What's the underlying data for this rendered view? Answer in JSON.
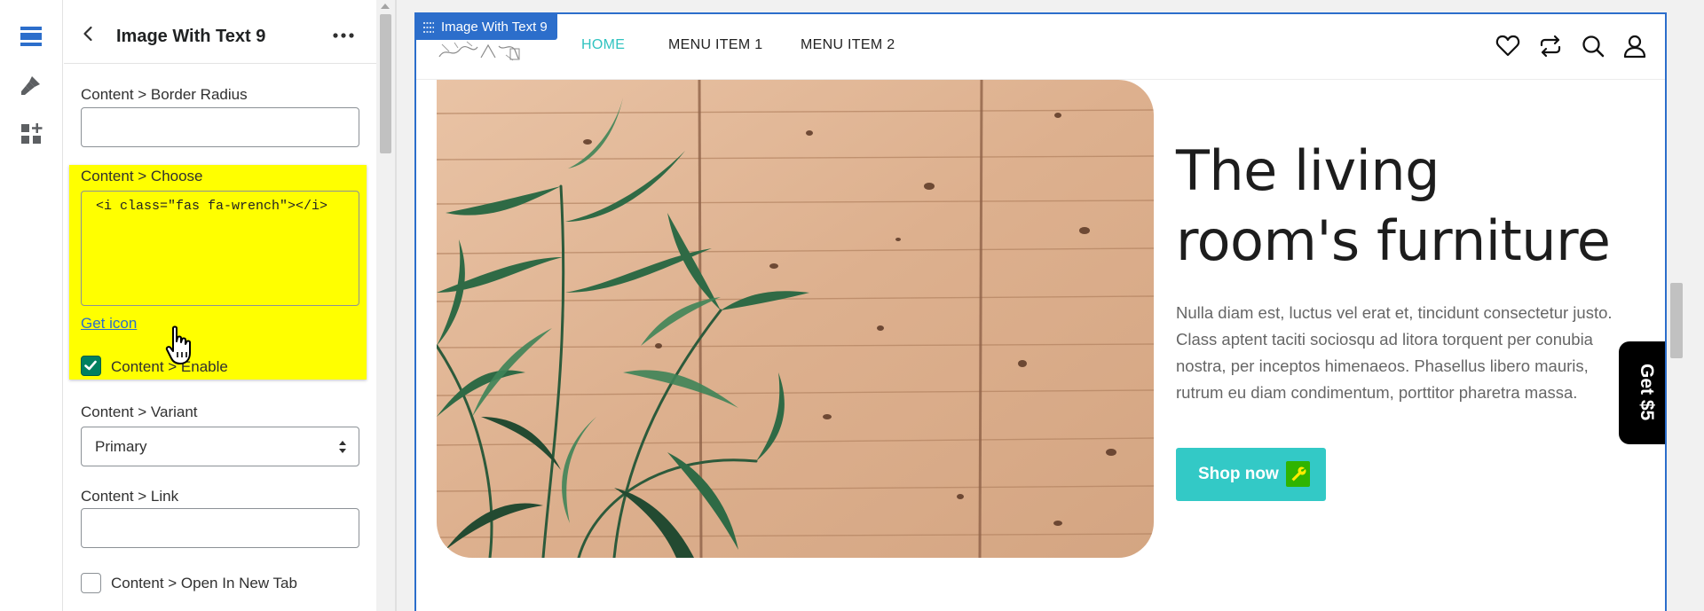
{
  "panel": {
    "title": "Image With Text 9",
    "fields": {
      "border_radius_label": "Content > Border Radius",
      "border_radius_value": "",
      "choose_label": "Content > Choose",
      "choose_value": "<i class=\"fas fa-wrench\"></i>",
      "get_icon_link": "Get icon",
      "enable_label": "Content > Enable",
      "enable_checked": true,
      "variant_label": "Content > Variant",
      "variant_value": "Primary",
      "link_label": "Content > Link",
      "link_value": "",
      "new_tab_label": "Content > Open In New Tab",
      "new_tab_checked": false
    }
  },
  "preview": {
    "section_badge": "Image With Text 9",
    "nav": [
      "HOME",
      "MENU ITEM 1",
      "MENU ITEM 2"
    ],
    "hero": {
      "title": "The living room's furniture",
      "text": "Nulla diam est, luctus vel erat et, tincidunt consectetur justo. Class aptent taciti sociosqu ad litora torquent per conubia nostra, per inceptos himenaeos. Phasellus libero mauris, rutrum eu diam condimentum, porttitor pharetra massa.",
      "button_label": "Shop now"
    },
    "promo_tab": "Get $5"
  },
  "colors": {
    "accent": "#33c9c6",
    "highlight": "#ffff00",
    "editor_blue": "#2c6ecb",
    "checkbox_green": "#008060"
  },
  "icons": {
    "rail": [
      "sections-icon",
      "theme-brush-icon",
      "apps-icon"
    ],
    "header": [
      "heart-icon",
      "compare-arrows-icon",
      "search-icon",
      "user-icon"
    ],
    "button": "wrench-icon"
  }
}
